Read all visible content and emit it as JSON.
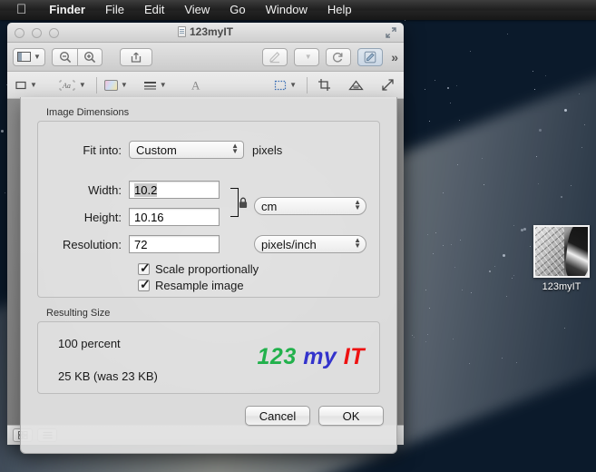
{
  "menubar": {
    "apple": "apple-logo",
    "items": [
      {
        "label": "Finder",
        "bold": true
      },
      {
        "label": "File",
        "bold": false
      },
      {
        "label": "Edit",
        "bold": false
      },
      {
        "label": "View",
        "bold": false
      },
      {
        "label": "Go",
        "bold": false
      },
      {
        "label": "Window",
        "bold": false
      },
      {
        "label": "Help",
        "bold": false
      }
    ]
  },
  "window": {
    "title": "123myIT",
    "toolbar_overflow": "»"
  },
  "sheet": {
    "groups": {
      "dimensions_label": "Image Dimensions",
      "resulting_label": "Resulting Size"
    },
    "fit_into": {
      "label": "Fit into:",
      "value": "Custom",
      "suffix": "pixels"
    },
    "width": {
      "label": "Width:",
      "value": "10.2"
    },
    "height": {
      "label": "Height:",
      "value": "10.16"
    },
    "resolution": {
      "label": "Resolution:",
      "value": "72"
    },
    "unit_size": "cm",
    "unit_resolution": "pixels/inch",
    "checkboxes": [
      {
        "label": "Scale proportionally",
        "checked": true
      },
      {
        "label": "Resample image",
        "checked": true
      }
    ],
    "resulting": {
      "percent": "100 percent",
      "bytes": "25 KB (was 23 KB)"
    },
    "buttons": {
      "cancel": "Cancel",
      "ok": "OK"
    }
  },
  "logo": {
    "part1": "123",
    "part2": "my",
    "part3": "IT",
    "color1": "#22b14c",
    "color2": "#3333cc",
    "color3": "#ee1111"
  },
  "desktop_icon": {
    "label": "123myIT"
  }
}
